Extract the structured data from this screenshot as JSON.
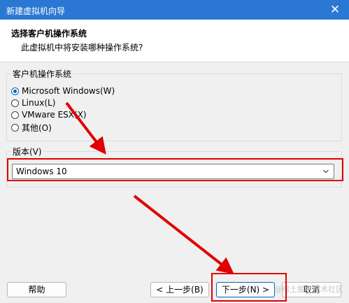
{
  "window": {
    "title": "新建虚拟机向导",
    "close_glyph": "✕"
  },
  "header": {
    "title": "选择客户机操作系统",
    "subtitle": "此虚拟机中将安装哪种操作系统?"
  },
  "guest_os": {
    "legend": "客户机操作系统",
    "options": [
      {
        "label": "Microsoft Windows(W)",
        "checked": true
      },
      {
        "label": "Linux(L)",
        "checked": false
      },
      {
        "label": "VMware ESX(X)",
        "checked": false
      },
      {
        "label": "其他(O)",
        "checked": false
      }
    ]
  },
  "version": {
    "legend": "版本(V)",
    "selected": "Windows 10"
  },
  "buttons": {
    "help": "帮助",
    "back": "< 上一步(B)",
    "next": "下一步(N) >",
    "cancel": "取消"
  },
  "watermark": "@稀土掘金技术社区",
  "colors": {
    "titlebar": "#2b78d4",
    "annotation_red": "#e00000",
    "accent": "#0067c0"
  },
  "icons": [
    "close-icon",
    "chevron-down-icon",
    "red-arrow-annotation"
  ]
}
